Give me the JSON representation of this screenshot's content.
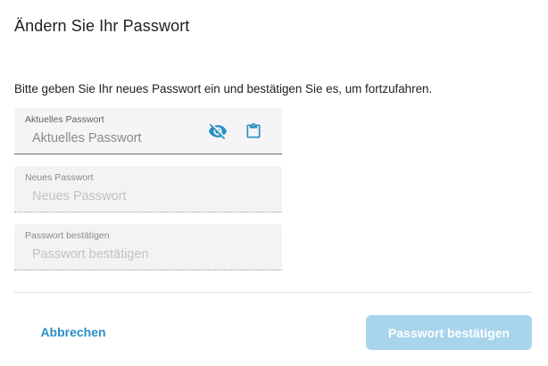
{
  "dialog": {
    "title": "Ändern Sie Ihr Passwort",
    "instructions": "Bitte geben Sie Ihr neues Passwort ein und bestätigen Sie es, um fortzufahren."
  },
  "fields": {
    "current": {
      "label": "Aktuelles Passwort",
      "placeholder": "Aktuelles Passwort",
      "value": ""
    },
    "new": {
      "label": "Neues Passwort",
      "placeholder": "Neues Passwort",
      "value": ""
    },
    "confirm": {
      "label": "Passwort bestätigen",
      "placeholder": "Passwort bestätigen",
      "value": ""
    }
  },
  "icons": {
    "visibility": "eye-off-icon",
    "paste": "clipboard-icon"
  },
  "actions": {
    "cancel_label": "Abbrechen",
    "confirm_label": "Passwort bestätigen",
    "confirm_disabled": true
  },
  "colors": {
    "accent": "#2a8fc6",
    "confirm_disabled_bg": "#a8d4ec",
    "field_bg": "#f5f5f5"
  }
}
